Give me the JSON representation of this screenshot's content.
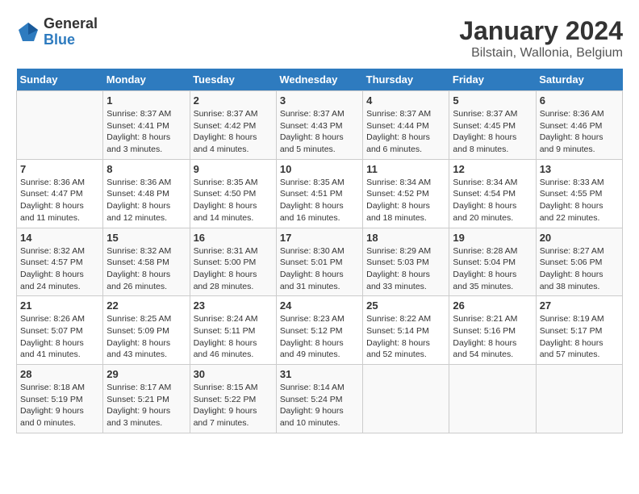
{
  "header": {
    "logo_line1": "General",
    "logo_line2": "Blue",
    "title": "January 2024",
    "subtitle": "Bilstain, Wallonia, Belgium"
  },
  "calendar": {
    "days_of_week": [
      "Sunday",
      "Monday",
      "Tuesday",
      "Wednesday",
      "Thursday",
      "Friday",
      "Saturday"
    ],
    "weeks": [
      [
        {
          "day": "",
          "info": ""
        },
        {
          "day": "1",
          "info": "Sunrise: 8:37 AM\nSunset: 4:41 PM\nDaylight: 8 hours\nand 3 minutes."
        },
        {
          "day": "2",
          "info": "Sunrise: 8:37 AM\nSunset: 4:42 PM\nDaylight: 8 hours\nand 4 minutes."
        },
        {
          "day": "3",
          "info": "Sunrise: 8:37 AM\nSunset: 4:43 PM\nDaylight: 8 hours\nand 5 minutes."
        },
        {
          "day": "4",
          "info": "Sunrise: 8:37 AM\nSunset: 4:44 PM\nDaylight: 8 hours\nand 6 minutes."
        },
        {
          "day": "5",
          "info": "Sunrise: 8:37 AM\nSunset: 4:45 PM\nDaylight: 8 hours\nand 8 minutes."
        },
        {
          "day": "6",
          "info": "Sunrise: 8:36 AM\nSunset: 4:46 PM\nDaylight: 8 hours\nand 9 minutes."
        }
      ],
      [
        {
          "day": "7",
          "info": "Sunrise: 8:36 AM\nSunset: 4:47 PM\nDaylight: 8 hours\nand 11 minutes."
        },
        {
          "day": "8",
          "info": "Sunrise: 8:36 AM\nSunset: 4:48 PM\nDaylight: 8 hours\nand 12 minutes."
        },
        {
          "day": "9",
          "info": "Sunrise: 8:35 AM\nSunset: 4:50 PM\nDaylight: 8 hours\nand 14 minutes."
        },
        {
          "day": "10",
          "info": "Sunrise: 8:35 AM\nSunset: 4:51 PM\nDaylight: 8 hours\nand 16 minutes."
        },
        {
          "day": "11",
          "info": "Sunrise: 8:34 AM\nSunset: 4:52 PM\nDaylight: 8 hours\nand 18 minutes."
        },
        {
          "day": "12",
          "info": "Sunrise: 8:34 AM\nSunset: 4:54 PM\nDaylight: 8 hours\nand 20 minutes."
        },
        {
          "day": "13",
          "info": "Sunrise: 8:33 AM\nSunset: 4:55 PM\nDaylight: 8 hours\nand 22 minutes."
        }
      ],
      [
        {
          "day": "14",
          "info": "Sunrise: 8:32 AM\nSunset: 4:57 PM\nDaylight: 8 hours\nand 24 minutes."
        },
        {
          "day": "15",
          "info": "Sunrise: 8:32 AM\nSunset: 4:58 PM\nDaylight: 8 hours\nand 26 minutes."
        },
        {
          "day": "16",
          "info": "Sunrise: 8:31 AM\nSunset: 5:00 PM\nDaylight: 8 hours\nand 28 minutes."
        },
        {
          "day": "17",
          "info": "Sunrise: 8:30 AM\nSunset: 5:01 PM\nDaylight: 8 hours\nand 31 minutes."
        },
        {
          "day": "18",
          "info": "Sunrise: 8:29 AM\nSunset: 5:03 PM\nDaylight: 8 hours\nand 33 minutes."
        },
        {
          "day": "19",
          "info": "Sunrise: 8:28 AM\nSunset: 5:04 PM\nDaylight: 8 hours\nand 35 minutes."
        },
        {
          "day": "20",
          "info": "Sunrise: 8:27 AM\nSunset: 5:06 PM\nDaylight: 8 hours\nand 38 minutes."
        }
      ],
      [
        {
          "day": "21",
          "info": "Sunrise: 8:26 AM\nSunset: 5:07 PM\nDaylight: 8 hours\nand 41 minutes."
        },
        {
          "day": "22",
          "info": "Sunrise: 8:25 AM\nSunset: 5:09 PM\nDaylight: 8 hours\nand 43 minutes."
        },
        {
          "day": "23",
          "info": "Sunrise: 8:24 AM\nSunset: 5:11 PM\nDaylight: 8 hours\nand 46 minutes."
        },
        {
          "day": "24",
          "info": "Sunrise: 8:23 AM\nSunset: 5:12 PM\nDaylight: 8 hours\nand 49 minutes."
        },
        {
          "day": "25",
          "info": "Sunrise: 8:22 AM\nSunset: 5:14 PM\nDaylight: 8 hours\nand 52 minutes."
        },
        {
          "day": "26",
          "info": "Sunrise: 8:21 AM\nSunset: 5:16 PM\nDaylight: 8 hours\nand 54 minutes."
        },
        {
          "day": "27",
          "info": "Sunrise: 8:19 AM\nSunset: 5:17 PM\nDaylight: 8 hours\nand 57 minutes."
        }
      ],
      [
        {
          "day": "28",
          "info": "Sunrise: 8:18 AM\nSunset: 5:19 PM\nDaylight: 9 hours\nand 0 minutes."
        },
        {
          "day": "29",
          "info": "Sunrise: 8:17 AM\nSunset: 5:21 PM\nDaylight: 9 hours\nand 3 minutes."
        },
        {
          "day": "30",
          "info": "Sunrise: 8:15 AM\nSunset: 5:22 PM\nDaylight: 9 hours\nand 7 minutes."
        },
        {
          "day": "31",
          "info": "Sunrise: 8:14 AM\nSunset: 5:24 PM\nDaylight: 9 hours\nand 10 minutes."
        },
        {
          "day": "",
          "info": ""
        },
        {
          "day": "",
          "info": ""
        },
        {
          "day": "",
          "info": ""
        }
      ]
    ]
  }
}
